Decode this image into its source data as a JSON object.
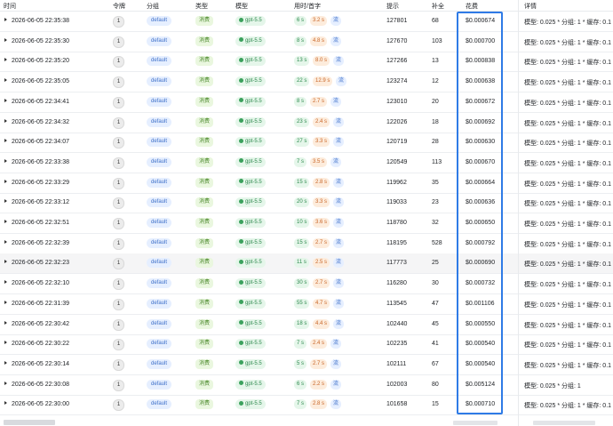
{
  "headers": [
    "时间",
    "令牌",
    "分组",
    "类型",
    "模型",
    "用时/首字",
    "提示",
    "补全",
    "花费",
    "详情"
  ],
  "rows": [
    {
      "time": "2026-06-05 22:35:38",
      "token": "1",
      "group": "default",
      "type": "消费",
      "model": "gpt-5.5",
      "use_time": "6 s",
      "first": "3.2 s",
      "stream": "流",
      "prompt": "127801",
      "completion": "68",
      "cost": "$0.000674",
      "detail": "模型: 0.025 * 分组: 1 * 缓存: 0.1"
    },
    {
      "time": "2026-06-05 22:35:30",
      "token": "1",
      "group": "default",
      "type": "消费",
      "model": "gpt-5.5",
      "use_time": "8 s",
      "first": "4.8 s",
      "stream": "流",
      "prompt": "127670",
      "completion": "103",
      "cost": "$0.000700",
      "detail": "模型: 0.025 * 分组: 1 * 缓存: 0.1"
    },
    {
      "time": "2026-06-05 22:35:20",
      "token": "1",
      "group": "default",
      "type": "消费",
      "model": "gpt-5.5",
      "use_time": "13 s",
      "first": "8.0 s",
      "stream": "流",
      "prompt": "127266",
      "completion": "13",
      "cost": "$0.000838",
      "detail": "模型: 0.025 * 分组: 1 * 缓存: 0.1"
    },
    {
      "time": "2026-06-05 22:35:05",
      "token": "1",
      "group": "default",
      "type": "消费",
      "model": "gpt-5.5",
      "use_time": "22 s",
      "first": "12.9 s",
      "stream": "流",
      "prompt": "123274",
      "completion": "12",
      "cost": "$0.000638",
      "detail": "模型: 0.025 * 分组: 1 * 缓存: 0.1"
    },
    {
      "time": "2026-06-05 22:34:41",
      "token": "1",
      "group": "default",
      "type": "消费",
      "model": "gpt-5.5",
      "use_time": "8 s",
      "first": "2.7 s",
      "stream": "流",
      "prompt": "123010",
      "completion": "20",
      "cost": "$0.000672",
      "detail": "模型: 0.025 * 分组: 1 * 缓存: 0.1"
    },
    {
      "time": "2026-06-05 22:34:32",
      "token": "1",
      "group": "default",
      "type": "消费",
      "model": "gpt-5.5",
      "use_time": "23 s",
      "first": "2.4 s",
      "stream": "流",
      "prompt": "122026",
      "completion": "18",
      "cost": "$0.000692",
      "detail": "模型: 0.025 * 分组: 1 * 缓存: 0.1"
    },
    {
      "time": "2026-06-05 22:34:07",
      "token": "1",
      "group": "default",
      "type": "消费",
      "model": "gpt-5.5",
      "use_time": "27 s",
      "first": "3.3 s",
      "stream": "流",
      "prompt": "120719",
      "completion": "28",
      "cost": "$0.000630",
      "detail": "模型: 0.025 * 分组: 1 * 缓存: 0.1"
    },
    {
      "time": "2026-06-05 22:33:38",
      "token": "1",
      "group": "default",
      "type": "消费",
      "model": "gpt-5.5",
      "use_time": "7 s",
      "first": "3.5 s",
      "stream": "流",
      "prompt": "120549",
      "completion": "113",
      "cost": "$0.000670",
      "detail": "模型: 0.025 * 分组: 1 * 缓存: 0.1"
    },
    {
      "time": "2026-06-05 22:33:29",
      "token": "1",
      "group": "default",
      "type": "消费",
      "model": "gpt-5.5",
      "use_time": "15 s",
      "first": "2.8 s",
      "stream": "流",
      "prompt": "119962",
      "completion": "35",
      "cost": "$0.000664",
      "detail": "模型: 0.025 * 分组: 1 * 缓存: 0.1"
    },
    {
      "time": "2026-06-05 22:33:12",
      "token": "1",
      "group": "default",
      "type": "消费",
      "model": "gpt-5.5",
      "use_time": "20 s",
      "first": "3.3 s",
      "stream": "流",
      "prompt": "119033",
      "completion": "23",
      "cost": "$0.000636",
      "detail": "模型: 0.025 * 分组: 1 * 缓存: 0.1"
    },
    {
      "time": "2026-06-05 22:32:51",
      "token": "1",
      "group": "default",
      "type": "消费",
      "model": "gpt-5.5",
      "use_time": "10 s",
      "first": "3.6 s",
      "stream": "流",
      "prompt": "118780",
      "completion": "32",
      "cost": "$0.000650",
      "detail": "模型: 0.025 * 分组: 1 * 缓存: 0.1"
    },
    {
      "time": "2026-06-05 22:32:39",
      "token": "1",
      "group": "default",
      "type": "消费",
      "model": "gpt-5.5",
      "use_time": "15 s",
      "first": "2.7 s",
      "stream": "流",
      "prompt": "118195",
      "completion": "528",
      "cost": "$0.000792",
      "detail": "模型: 0.025 * 分组: 1 * 缓存: 0.1"
    },
    {
      "time": "2026-06-05 22:32:23",
      "token": "1",
      "group": "default",
      "type": "消费",
      "model": "gpt-5.5",
      "use_time": "11 s",
      "first": "2.5 s",
      "stream": "流",
      "prompt": "117773",
      "completion": "25",
      "cost": "$0.000690",
      "detail": "模型: 0.025 * 分组: 1 * 缓存: 0.1",
      "highlight": true
    },
    {
      "time": "2026-06-05 22:32:10",
      "token": "1",
      "group": "default",
      "type": "消费",
      "model": "gpt-5.5",
      "use_time": "30 s",
      "first": "2.7 s",
      "stream": "流",
      "prompt": "116280",
      "completion": "30",
      "cost": "$0.000732",
      "detail": "模型: 0.025 * 分组: 1 * 缓存: 0.1"
    },
    {
      "time": "2026-06-05 22:31:39",
      "token": "1",
      "group": "default",
      "type": "消费",
      "model": "gpt-5.5",
      "use_time": "55 s",
      "first": "4.7 s",
      "stream": "流",
      "prompt": "113545",
      "completion": "47",
      "cost": "$0.001106",
      "detail": "模型: 0.025 * 分组: 1 * 缓存: 0.1"
    },
    {
      "time": "2026-06-05 22:30:42",
      "token": "1",
      "group": "default",
      "type": "消费",
      "model": "gpt-5.5",
      "use_time": "18 s",
      "first": "4.4 s",
      "stream": "流",
      "prompt": "102440",
      "completion": "45",
      "cost": "$0.000550",
      "detail": "模型: 0.025 * 分组: 1 * 缓存: 0.1"
    },
    {
      "time": "2026-06-05 22:30:22",
      "token": "1",
      "group": "default",
      "type": "消费",
      "model": "gpt-5.5",
      "use_time": "7 s",
      "first": "2.4 s",
      "stream": "流",
      "prompt": "102235",
      "completion": "41",
      "cost": "$0.000540",
      "detail": "模型: 0.025 * 分组: 1 * 缓存: 0.1"
    },
    {
      "time": "2026-06-05 22:30:14",
      "token": "1",
      "group": "default",
      "type": "消费",
      "model": "gpt-5.5",
      "use_time": "5 s",
      "first": "2.7 s",
      "stream": "流",
      "prompt": "102111",
      "completion": "67",
      "cost": "$0.000540",
      "detail": "模型: 0.025 * 分组: 1 * 缓存: 0.1"
    },
    {
      "time": "2026-06-05 22:30:08",
      "token": "1",
      "group": "default",
      "type": "消费",
      "model": "gpt-5.5",
      "use_time": "6 s",
      "first": "2.2 s",
      "stream": "流",
      "prompt": "102003",
      "completion": "80",
      "cost": "$0.005124",
      "detail": "模型: 0.025 * 分组: 1"
    },
    {
      "time": "2026-06-05 22:30:00",
      "token": "1",
      "group": "default",
      "type": "消费",
      "model": "gpt-5.5",
      "use_time": "7 s",
      "first": "2.8 s",
      "stream": "流",
      "prompt": "101658",
      "completion": "15",
      "cost": "$0.000710",
      "detail": "模型: 0.025 * 分组: 1 * 缓存: 0.1"
    }
  ]
}
